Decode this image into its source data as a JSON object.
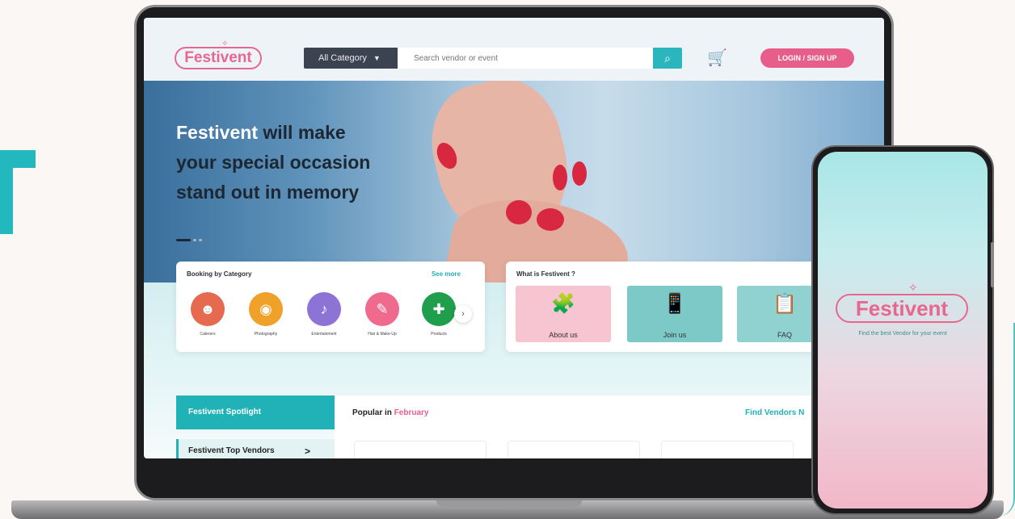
{
  "nav": {
    "logo": "Festivent",
    "category": "All Category",
    "search_placeholder": "Search vendor or event",
    "login": "LOGIN / SIGN UP"
  },
  "hero": {
    "highlight": "Festivent",
    "line1": " will make",
    "line2": "your special occasion",
    "line3": "stand out in memory"
  },
  "booking": {
    "title": "Booking by Category",
    "see_more": "See more",
    "items": [
      {
        "label": "Caterers",
        "color": "#e56a4f",
        "icon": "chef-icon"
      },
      {
        "label": "Photography",
        "color": "#f0a12a",
        "icon": "camera-icon"
      },
      {
        "label": "Entertainment",
        "color": "#8d73d6",
        "icon": "microphone-icon"
      },
      {
        "label": "Hair & Make-Up",
        "color": "#ef6a8d",
        "icon": "makeup-icon"
      },
      {
        "label": "Products",
        "color": "#1f9e4c",
        "icon": "gift-icon"
      }
    ]
  },
  "what": {
    "title": "What is Festivent ?",
    "tiles": [
      {
        "label": "About us",
        "bg": "#f7c4d1"
      },
      {
        "label": "Join us",
        "bg": "#7cc9c7"
      },
      {
        "label": "FAQ",
        "bg": "#8fd2d0"
      }
    ]
  },
  "spotlight": {
    "title": "Festivent Spotlight",
    "item": "Festivent Top Vendors"
  },
  "popular": {
    "prefix": "Popular in ",
    "month": "February",
    "find": "Find Vendors N"
  },
  "phone": {
    "logo": "Festivent",
    "tagline": "Find the best Vendor for your event"
  },
  "colors": {
    "accent_pink": "#e85e8b",
    "accent_teal": "#20b2b7"
  }
}
